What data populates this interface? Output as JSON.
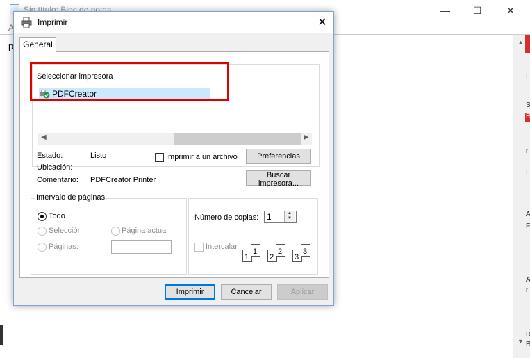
{
  "notepad": {
    "title": "Sin título: Bloc de notas",
    "menu_first": "A",
    "text_fragment": "p",
    "minimize_glyph": "—",
    "maximize_glyph": "☐",
    "close_glyph": "✕",
    "side_letters": [
      "I",
      "S",
      "R",
      "r",
      "I",
      "A",
      "F",
      "A",
      "r",
      "R",
      "R"
    ]
  },
  "dialog": {
    "title": "Imprimir",
    "close_glyph": "✕",
    "tab_label": "General",
    "select_printer_label": "Seleccionar impresora",
    "printers": [
      {
        "name": "PDFCreator",
        "selected": true
      }
    ],
    "status_label": "Estado:",
    "status_value": "Listo",
    "location_label": "Ubicación:",
    "location_value": "",
    "comment_label": "Comentario:",
    "comment_value": "PDFCreator Printer",
    "print_to_file_label": "Imprimir a un archivo",
    "preferences_button": "Preferencias",
    "find_printer_button": "Buscar impresora...",
    "page_range_label": "Intervalo de páginas",
    "range_all": "Todo",
    "range_selection": "Selección",
    "range_current": "Página actual",
    "range_pages": "Páginas:",
    "pages_value": "",
    "copies_label": "Número de copias:",
    "copies_value": "1",
    "collate_label": "Intercalar",
    "collate_icons": [
      "1",
      "1",
      "2",
      "2",
      "3",
      "3"
    ],
    "print_button": "Imprimir",
    "cancel_button": "Cancelar",
    "apply_button": "Aplicar"
  },
  "colors": {
    "highlight_box": "#e00000",
    "selection": "#cce8ff",
    "accent": "#0078d7"
  }
}
